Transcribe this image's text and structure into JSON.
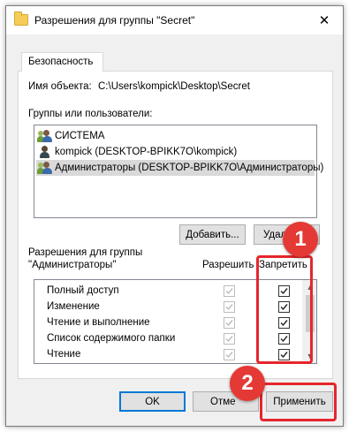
{
  "window": {
    "title": "Разрешения для группы \"Secret\"",
    "close_glyph": "✕"
  },
  "tab": {
    "label": "Безопасность"
  },
  "object": {
    "label": "Имя объекта:",
    "path": "C:\\Users\\kompick\\Desktop\\Secret"
  },
  "groups": {
    "label": "Группы или пользователи:",
    "items": [
      {
        "name": "СИСТЕМА",
        "icon": "group-icon"
      },
      {
        "name": "kompick (DESKTOP-BPIKK7O\\kompick)",
        "icon": "user-icon"
      },
      {
        "name": "Администраторы (DESKTOP-BPIKK7O\\Администраторы)",
        "icon": "group-icon",
        "selected": true
      }
    ]
  },
  "buttons": {
    "add": "Добавить...",
    "remove": "Удал",
    "ok": "OK",
    "cancel": "Отме",
    "apply": "Применить"
  },
  "permissions": {
    "label_line1": "Разрешения для группы",
    "label_line2": "\"Администраторы\"",
    "allow_header": "Разрешить",
    "deny_header": "Запретить",
    "rows": [
      {
        "name": "Полный доступ",
        "allow": true,
        "allow_disabled": true,
        "deny": true
      },
      {
        "name": "Изменение",
        "allow": true,
        "allow_disabled": true,
        "deny": true
      },
      {
        "name": "Чтение и выполнение",
        "allow": true,
        "allow_disabled": true,
        "deny": true
      },
      {
        "name": "Список содержимого папки",
        "allow": true,
        "allow_disabled": true,
        "deny": true
      },
      {
        "name": "Чтение",
        "allow": true,
        "allow_disabled": true,
        "deny": true
      }
    ]
  },
  "annotations": {
    "badge1": "1",
    "badge2": "2",
    "color": "#e5262c"
  }
}
